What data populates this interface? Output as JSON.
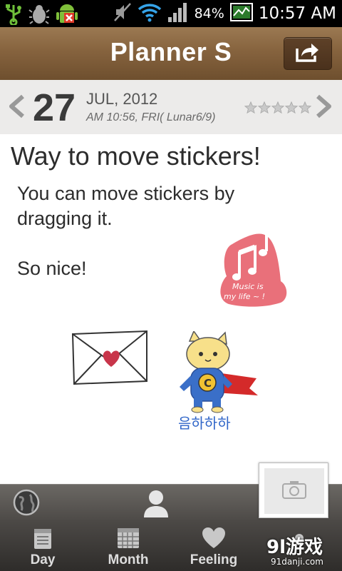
{
  "status_bar": {
    "battery": "84%",
    "time": "10:57 AM",
    "icons": [
      "usb-icon",
      "bug-icon",
      "android-error-icon",
      "mute-icon",
      "wifi-icon",
      "signal-icon",
      "battery-icon",
      "gallery-icon"
    ]
  },
  "header": {
    "title": "Planner S",
    "share_icon": "share-icon"
  },
  "date_bar": {
    "day": "27",
    "month_year": "JUL, 2012",
    "time_detail": "AM 10:56, FRI( Lunar6/9)",
    "rating_stars": 5,
    "rating_value": 0
  },
  "note": {
    "title": "Way to move stickers!",
    "body": "You can move stickers by dragging it.\n\nSo nice!"
  },
  "stickers": {
    "music_text": "Music is my life ~ !",
    "cat_caption": "음하하하",
    "cat_badge": "C"
  },
  "bottom_tabs": [
    {
      "label": "Day",
      "icon": "calendar-day-icon"
    },
    {
      "label": "Month",
      "icon": "calendar-month-icon"
    },
    {
      "label": "Feeling",
      "icon": "heart-icon"
    },
    {
      "label": "",
      "icon": "more-icon"
    }
  ],
  "watermark": {
    "logo": "9l游戏",
    "url": "91danji.com"
  },
  "colors": {
    "header_brown": "#86633e",
    "date_bg": "#ecebea",
    "heart_red": "#c8354a",
    "sticker_pink": "#e9707a",
    "cape_red": "#d42a2a",
    "cat_blue": "#3a6fc8"
  }
}
